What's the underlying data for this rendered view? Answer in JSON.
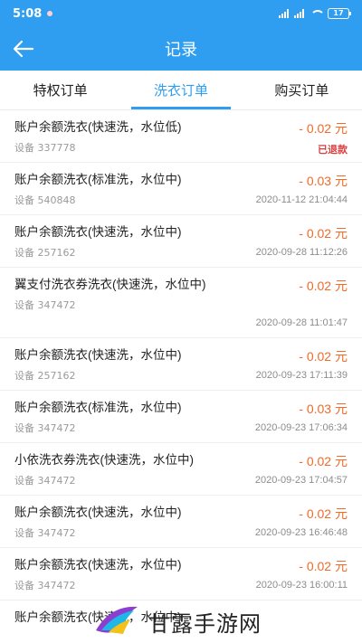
{
  "status_bar": {
    "time": "5:08",
    "battery": "17"
  },
  "header": {
    "title": "记录"
  },
  "tabs": [
    {
      "label": "特权订单",
      "active": false
    },
    {
      "label": "洗衣订单",
      "active": true
    },
    {
      "label": "购买订单",
      "active": false
    }
  ],
  "records": [
    {
      "title": "账户余额洗衣(快速洗，水位低)",
      "device": "设备 337778",
      "amount": "- 0.02 元",
      "meta": "已退款"
    },
    {
      "title": "账户余额洗衣(标准洗，水位中)",
      "device": "设备 540848",
      "amount": "- 0.03 元",
      "meta": "2020-11-12 21:04:44"
    },
    {
      "title": "账户余额洗衣(快速洗，水位中)",
      "device": "设备 257162",
      "amount": "- 0.02 元",
      "meta": "2020-09-28 11:12:26"
    },
    {
      "title": "翼支付洗衣券洗衣(快速洗，水位中)",
      "device": "设备 347472",
      "amount": "- 0.02 元",
      "meta": "2020-09-28 11:01:47"
    },
    {
      "title": "账户余额洗衣(快速洗，水位中)",
      "device": "设备 257162",
      "amount": "- 0.02 元",
      "meta": "2020-09-23 17:11:39"
    },
    {
      "title": "账户余额洗衣(标准洗，水位中)",
      "device": "设备 347472",
      "amount": "- 0.03 元",
      "meta": "2020-09-23 17:06:34"
    },
    {
      "title": "小依洗衣券洗衣(快速洗，水位中)",
      "device": "设备 347472",
      "amount": "- 0.02 元",
      "meta": "2020-09-23 17:04:57"
    },
    {
      "title": "账户余额洗衣(快速洗，水位中)",
      "device": "设备 347472",
      "amount": "- 0.02 元",
      "meta": "2020-09-23 16:46:48"
    },
    {
      "title": "账户余额洗衣(快速洗，水位中)",
      "device": "设备 347472",
      "amount": "- 0.02 元",
      "meta": "2020-09-23 16:00:11"
    },
    {
      "title": "账户余额洗衣(快速洗，水位中)",
      "device": "",
      "amount": "",
      "meta": ""
    }
  ],
  "watermark": {
    "text": "甘露手游网"
  },
  "colors": {
    "primary": "#2f9ef1",
    "amount": "#f06a28",
    "refund": "#d64040"
  }
}
